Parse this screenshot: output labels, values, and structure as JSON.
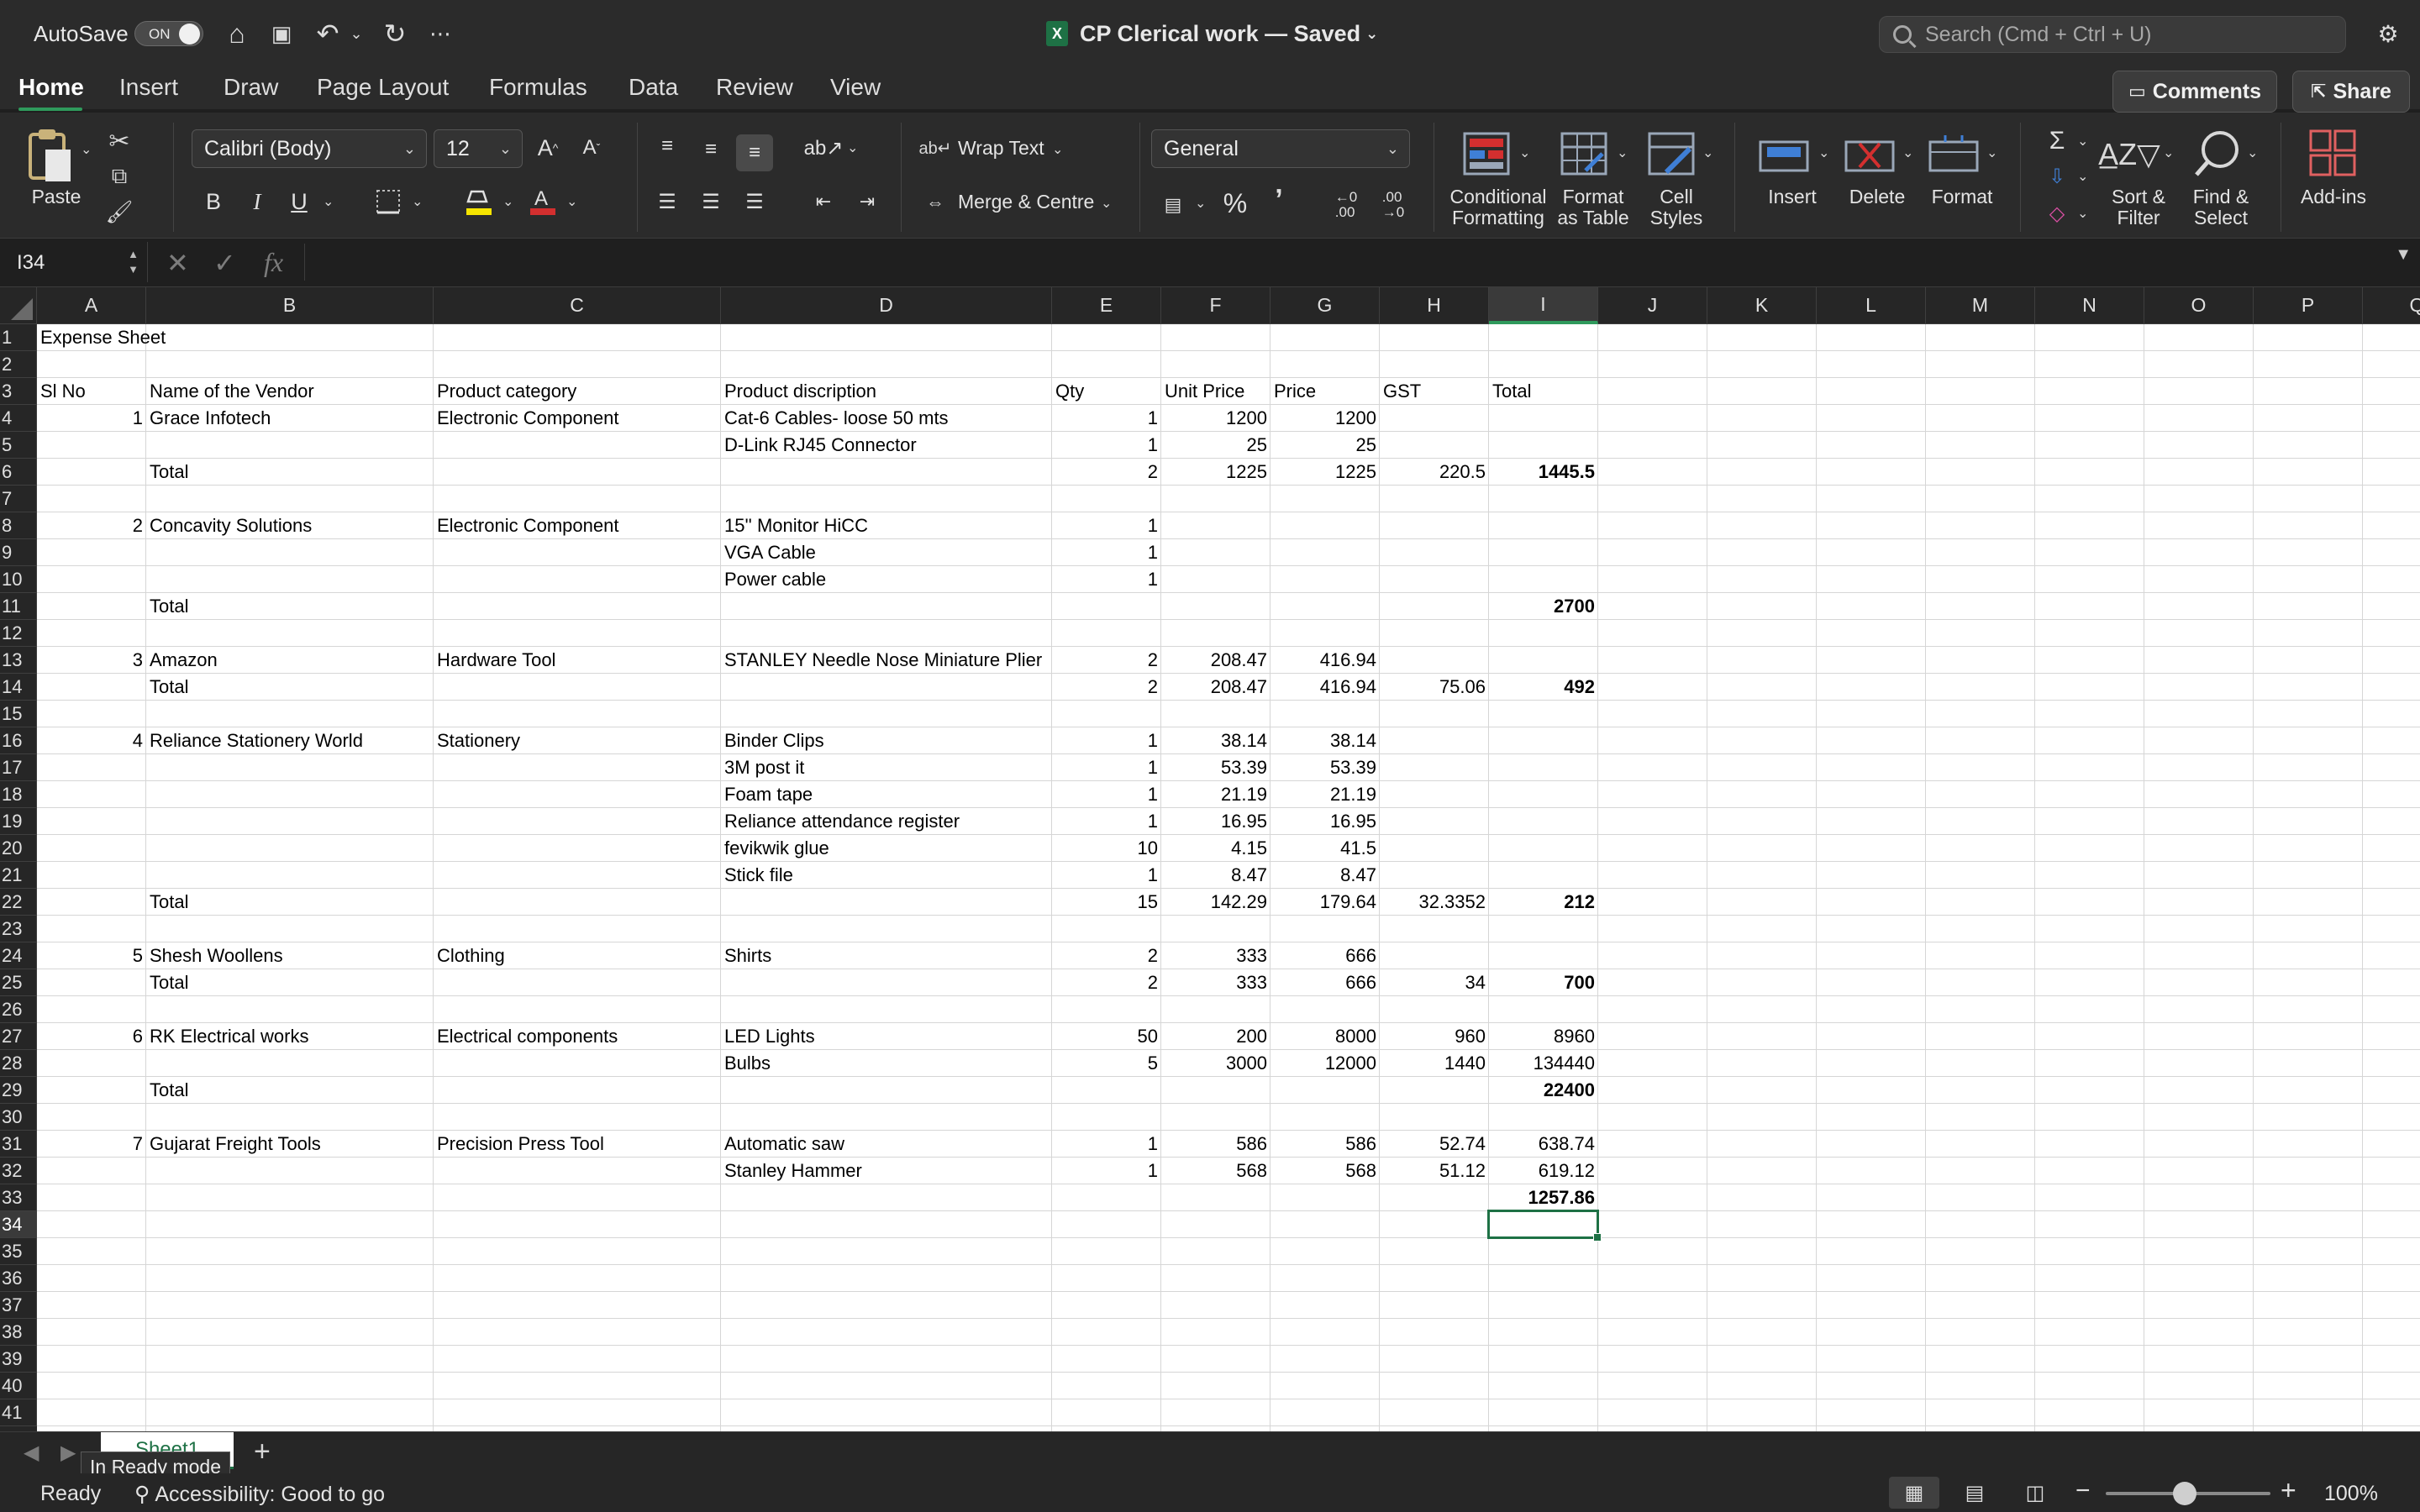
{
  "titlebar": {
    "autosave_label": "AutoSave",
    "autosave_state": "ON",
    "title": "CP Clerical work — Saved",
    "search_placeholder": "Search (Cmd + Ctrl + U)"
  },
  "ribbon_tabs": [
    "Home",
    "Insert",
    "Draw",
    "Page Layout",
    "Formulas",
    "Data",
    "Review",
    "View"
  ],
  "ribbon_buttons": {
    "comments": "Comments",
    "share": "Share"
  },
  "ribbon": {
    "paste": "Paste",
    "font_name": "Calibri (Body)",
    "font_size": "12",
    "bold": "B",
    "italic": "I",
    "underline": "U",
    "wrap_text": "Wrap Text",
    "merge_centre": "Merge & Centre",
    "number_format": "General",
    "conditional_formatting": [
      "Conditional",
      "Formatting"
    ],
    "format_as_table": [
      "Format",
      "as Table"
    ],
    "cell_styles": [
      "Cell",
      "Styles"
    ],
    "insert": "Insert",
    "delete": "Delete",
    "format": "Format",
    "sort_filter": [
      "Sort &",
      "Filter"
    ],
    "find_select": [
      "Find &",
      "Select"
    ],
    "add_ins": "Add-ins",
    "percent": "%",
    "comma": "ʼ"
  },
  "formula_bar": {
    "name_box": "I34",
    "fx": "fx",
    "formula": ""
  },
  "columns": [
    "A",
    "B",
    "C",
    "D",
    "E",
    "F",
    "G",
    "H",
    "I",
    "J",
    "K",
    "L",
    "M",
    "N",
    "O",
    "P",
    "Q"
  ],
  "selected_column": "I",
  "selected_row": 34,
  "rows": [
    [
      "Expense Sheet",
      "",
      "",
      "",
      "",
      "",
      "",
      "",
      ""
    ],
    [
      "",
      "",
      "",
      "",
      "",
      "",
      "",
      "",
      ""
    ],
    [
      "Sl No",
      "Name of the Vendor",
      "Product category",
      "Product discription",
      "Qty",
      "Unit Price",
      "Price",
      "GST",
      "Total"
    ],
    [
      "1",
      "Grace Infotech",
      "Electronic Component",
      "Cat-6 Cables- loose 50 mts",
      "1",
      "1200",
      "1200",
      "",
      ""
    ],
    [
      "",
      "",
      "",
      "D-Link RJ45 Connector",
      "1",
      "25",
      "25",
      "",
      ""
    ],
    [
      "",
      "Total",
      "",
      "",
      "2",
      "1225",
      "1225",
      "220.5",
      "1445.5"
    ],
    [
      "",
      "",
      "",
      "",
      "",
      "",
      "",
      "",
      ""
    ],
    [
      "2",
      "Concavity Solutions",
      "Electronic Component",
      "15'' Monitor HiCC",
      "1",
      "",
      "",
      "",
      ""
    ],
    [
      "",
      "",
      "",
      "VGA Cable",
      "1",
      "",
      "",
      "",
      ""
    ],
    [
      "",
      "",
      "",
      "Power cable",
      "1",
      "",
      "",
      "",
      ""
    ],
    [
      "",
      "Total",
      "",
      "",
      "",
      "",
      "",
      "",
      "2700"
    ],
    [
      "",
      "",
      "",
      "",
      "",
      "",
      "",
      "",
      ""
    ],
    [
      "3",
      "Amazon",
      "Hardware Tool",
      "STANLEY  Needle Nose Miniature Plier",
      "2",
      "208.47",
      "416.94",
      "",
      ""
    ],
    [
      "",
      "Total",
      "",
      "",
      "2",
      "208.47",
      "416.94",
      "75.06",
      "492"
    ],
    [
      "",
      "",
      "",
      "",
      "",
      "",
      "",
      "",
      ""
    ],
    [
      "4",
      "Reliance Stationery World",
      "Stationery",
      "Binder Clips",
      "1",
      "38.14",
      "38.14",
      "",
      ""
    ],
    [
      "",
      "",
      "",
      "3M post it",
      "1",
      "53.39",
      "53.39",
      "",
      ""
    ],
    [
      "",
      "",
      "",
      "Foam tape",
      "1",
      "21.19",
      "21.19",
      "",
      ""
    ],
    [
      "",
      "",
      "",
      "Reliance attendance register",
      "1",
      "16.95",
      "16.95",
      "",
      ""
    ],
    [
      "",
      "",
      "",
      "fevikwik glue",
      "10",
      "4.15",
      "41.5",
      "",
      ""
    ],
    [
      "",
      "",
      "",
      "Stick file",
      "1",
      "8.47",
      "8.47",
      "",
      ""
    ],
    [
      "",
      "Total",
      "",
      "",
      "15",
      "142.29",
      "179.64",
      "32.3352",
      "212"
    ],
    [
      "",
      "",
      "",
      "",
      "",
      "",
      "",
      "",
      ""
    ],
    [
      "5",
      "Shesh Woollens",
      "Clothing",
      "Shirts",
      "2",
      "333",
      "666",
      "",
      ""
    ],
    [
      "",
      "Total",
      "",
      "",
      "2",
      "333",
      "666",
      "34",
      "700"
    ],
    [
      "",
      "",
      "",
      "",
      "",
      "",
      "",
      "",
      ""
    ],
    [
      "6",
      "RK Electrical works",
      "Electrical components",
      "LED Lights",
      "50",
      "200",
      "8000",
      "960",
      "8960"
    ],
    [
      "",
      "",
      "",
      "Bulbs",
      "5",
      "3000",
      "12000",
      "1440",
      "134440"
    ],
    [
      "",
      "Total",
      "",
      "",
      "",
      "",
      "",
      "",
      "22400"
    ],
    [
      "",
      "",
      "",
      "",
      "",
      "",
      "",
      "",
      ""
    ],
    [
      "7",
      "Gujarat Freight Tools",
      "Precision Press Tool",
      "Automatic saw",
      "1",
      "586",
      "586",
      "52.74",
      "638.74"
    ],
    [
      "",
      "",
      "",
      "Stanley Hammer",
      "1",
      "568",
      "568",
      "51.12",
      "619.12"
    ],
    [
      "",
      "",
      "",
      "",
      "",
      "",
      "",
      "",
      "1257.86"
    ],
    [
      "",
      "",
      "",
      "",
      "",
      "",
      "",
      "",
      ""
    ],
    [
      "",
      "",
      "",
      "",
      "",
      "",
      "",
      "",
      ""
    ],
    [
      "",
      "",
      "",
      "",
      "",
      "",
      "",
      "",
      ""
    ],
    [
      "",
      "",
      "",
      "",
      "",
      "",
      "",
      "",
      ""
    ],
    [
      "",
      "",
      "",
      "",
      "",
      "",
      "",
      "",
      ""
    ],
    [
      "",
      "",
      "",
      "",
      "",
      "",
      "",
      "",
      ""
    ],
    [
      "",
      "",
      "",
      "",
      "",
      "",
      "",
      "",
      ""
    ],
    [
      "",
      "",
      "",
      "",
      "",
      "",
      "",
      "",
      ""
    ]
  ],
  "bold_total_rows": [
    6,
    11,
    14,
    22,
    25,
    29,
    33
  ],
  "sheet_tabs": [
    "Sheet1"
  ],
  "tooltip": "In Ready mode",
  "status": {
    "mode": "Ready",
    "accessibility": "Accessibility: Good to go",
    "zoom": "100%"
  },
  "colors": {
    "accent": "#2f9a5c",
    "excel_green": "#1e7145"
  }
}
